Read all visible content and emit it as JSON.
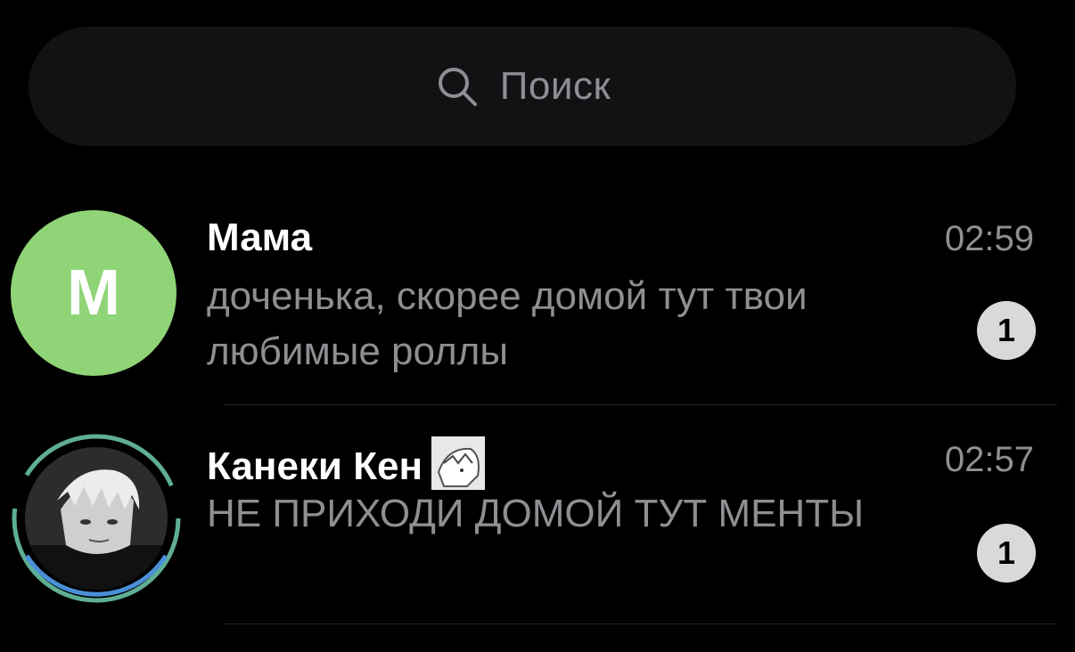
{
  "search": {
    "placeholder": "Поиск",
    "icon": "search-icon"
  },
  "chats": [
    {
      "name": "Мама",
      "avatar_letter": "М",
      "avatar_color": "#8fd477",
      "time": "02:59",
      "preview": "доченька, скорее домой тут твои любимые роллы",
      "unread": "1"
    },
    {
      "name": "Канеки Кен",
      "avatar_ring_colors": [
        "#5fae94",
        "#4a90d9"
      ],
      "time": "02:57",
      "preview": "НЕ ПРИХОДИ ДОМОЙ ТУТ МЕНТЫ",
      "unread": "1"
    }
  ],
  "colors": {
    "background": "#000000",
    "secondary_text": "#8e8e93",
    "badge": "#d9d9d9"
  }
}
